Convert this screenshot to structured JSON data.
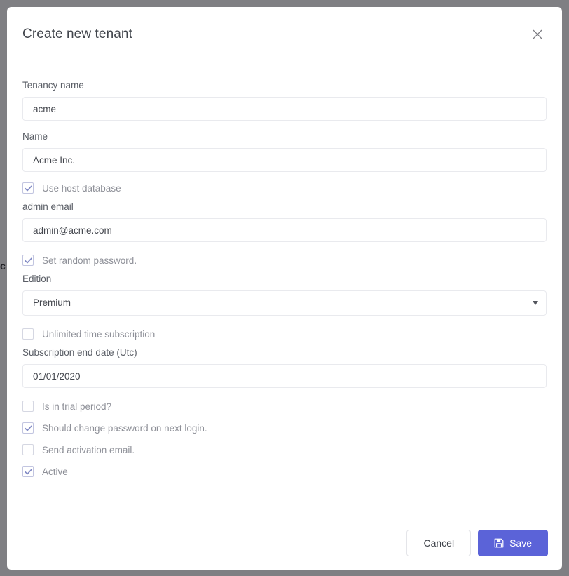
{
  "backdrop": {
    "bleed_text": "c",
    "color": "#7f7f83"
  },
  "modal": {
    "title": "Create new tenant",
    "close_icon": "close-icon",
    "form": {
      "tenancy_name": {
        "label": "Tenancy name",
        "value": "acme",
        "placeholder": ""
      },
      "name": {
        "label": "Name",
        "value": "Acme Inc.",
        "placeholder": ""
      },
      "use_host_database": {
        "label": "Use host database",
        "checked": true
      },
      "admin_email": {
        "label": "admin email",
        "value": "admin@acme.com",
        "placeholder": ""
      },
      "set_random_password": {
        "label": "Set random password.",
        "checked": true
      },
      "edition": {
        "label": "Edition",
        "value": "Premium",
        "options": [
          "Premium"
        ],
        "caret_icon": "chevron-down-icon"
      },
      "unlimited_time_subscription": {
        "label": "Unlimited time subscription",
        "checked": false
      },
      "subscription_end_date": {
        "label": "Subscription end date (Utc)",
        "value": "01/01/2020",
        "placeholder": ""
      },
      "is_in_trial_period": {
        "label": "Is in trial period?",
        "checked": false
      },
      "should_change_password": {
        "label": "Should change password on next login.",
        "checked": true
      },
      "send_activation_email": {
        "label": "Send activation email.",
        "checked": false
      },
      "active": {
        "label": "Active",
        "checked": true
      }
    },
    "footer": {
      "cancel_label": "Cancel",
      "save_label": "Save",
      "save_icon": "floppy-disk-save-icon",
      "save_color": "#5b63d8"
    }
  }
}
